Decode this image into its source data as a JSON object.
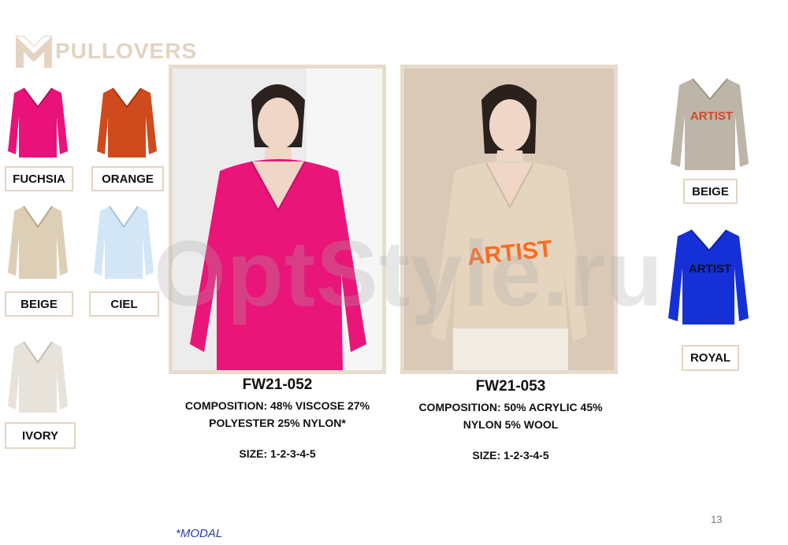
{
  "header": {
    "title": "PULLOVERS"
  },
  "colors": {
    "fuchsia": "#e8127a",
    "orange": "#cf4a1c",
    "beige": "#ddcfb6",
    "ciel": "#d3e6f6",
    "ivory": "#e8e3da",
    "royal": "#1530d6",
    "grey_beige": "#bdb5a7",
    "accent_border": "#e2d6c4",
    "artist_orange": "#ff6a1f",
    "logo": "#e3d3c0"
  },
  "swatches_left": [
    {
      "label": "FUCHSIA",
      "icon": "sweater-icon"
    },
    {
      "label": "ORANGE",
      "icon": "sweater-icon"
    },
    {
      "label": "BEIGE",
      "icon": "sweater-icon"
    },
    {
      "label": "CIEL",
      "icon": "sweater-icon"
    },
    {
      "label": "IVORY",
      "icon": "sweater-icon"
    }
  ],
  "swatches_right": [
    {
      "label": "BEIGE",
      "print": "ARTIST"
    },
    {
      "label": "ROYAL",
      "print": "ARTIST"
    }
  ],
  "products": [
    {
      "code": "FW21-052",
      "composition_line1": "COMPOSITION: 48% VISCOSE 27%",
      "composition_line2": "POLYESTER 25% NYLON*",
      "size": "SIZE: 1-2-3-4-5"
    },
    {
      "code": "FW21-053",
      "composition_line1": "COMPOSITION: 50% ACRYLIC 45%",
      "composition_line2": "NYLON 5% WOOL",
      "size": "SIZE: 1-2-3-4-5",
      "print": "ARTIST"
    }
  ],
  "watermark": "OptStyle.ru",
  "page_number": "13",
  "footnote": "*MODAL"
}
